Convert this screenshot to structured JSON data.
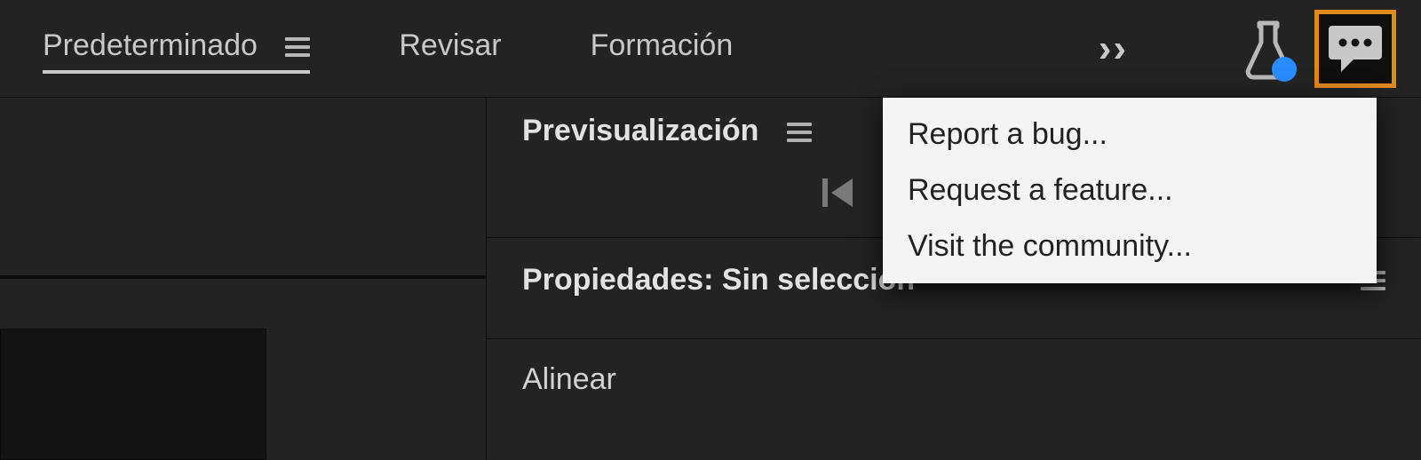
{
  "workspaces": {
    "active": "Predeterminado",
    "items": [
      {
        "label": "Predeterminado"
      },
      {
        "label": "Revisar"
      },
      {
        "label": "Formación"
      }
    ]
  },
  "panels": {
    "preview": {
      "title": "Previsualización"
    },
    "properties": {
      "title": "Propiedades: Sin selección"
    },
    "align": {
      "title": "Alinear"
    }
  },
  "feedback_menu": {
    "items": [
      {
        "label": "Report a bug..."
      },
      {
        "label": "Request a feature..."
      },
      {
        "label": "Visit the community..."
      }
    ]
  }
}
